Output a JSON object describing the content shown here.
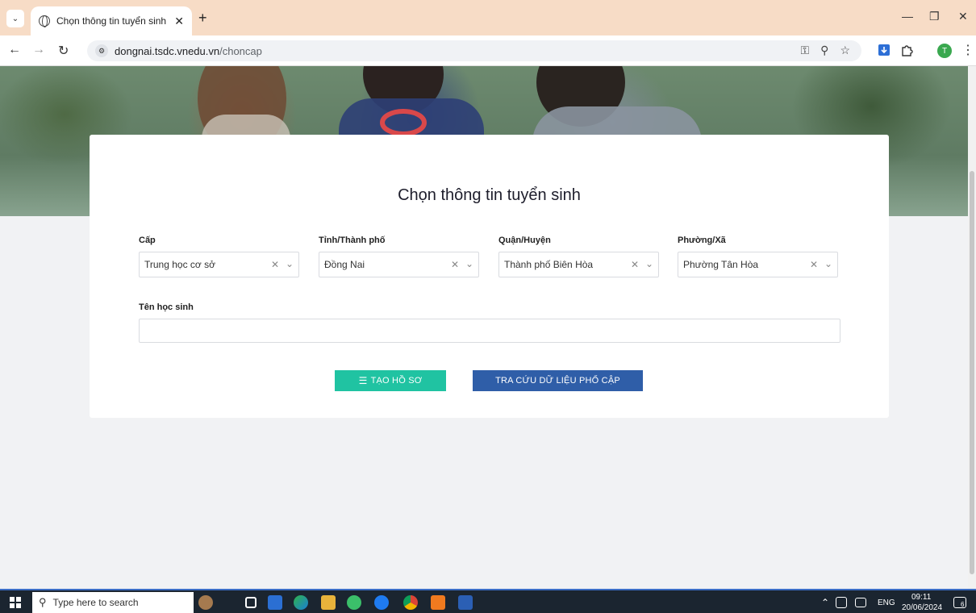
{
  "browser": {
    "tab_title": "Chọn thông tin tuyển sinh - Đồ",
    "tab_close": "✕",
    "new_tab": "+",
    "url_host": "dongnai.tsdc.vnedu.vn",
    "url_path": "/choncap",
    "profile_initial": "T"
  },
  "page": {
    "title": "Chọn thông tin tuyển sinh",
    "fields": {
      "cap": {
        "label": "Cấp",
        "value": "Trung học cơ sở"
      },
      "tinh": {
        "label": "Tỉnh/Thành phố",
        "value": "Đồng Nai"
      },
      "quan": {
        "label": "Quận/Huyện",
        "value": "Thành phố Biên Hòa"
      },
      "phuong": {
        "label": "Phường/Xã",
        "value": "Phường Tân Hòa"
      },
      "ten": {
        "label": "Tên học sinh",
        "value": ""
      }
    },
    "buttons": {
      "create": "TẠO HỒ SƠ",
      "lookup": "TRA CỨU DỮ LIỆU PHỔ CẬP"
    }
  },
  "taskbar": {
    "search_placeholder": "Type here to search",
    "language": "ENG",
    "time": "09:11",
    "date": "20/06/2024",
    "notification_count": "6"
  },
  "colors": {
    "green_button": "#20c3a2",
    "blue_button": "#2f5ea8",
    "tabbar": "#f7dcc6",
    "taskbar": "#1b2530"
  }
}
